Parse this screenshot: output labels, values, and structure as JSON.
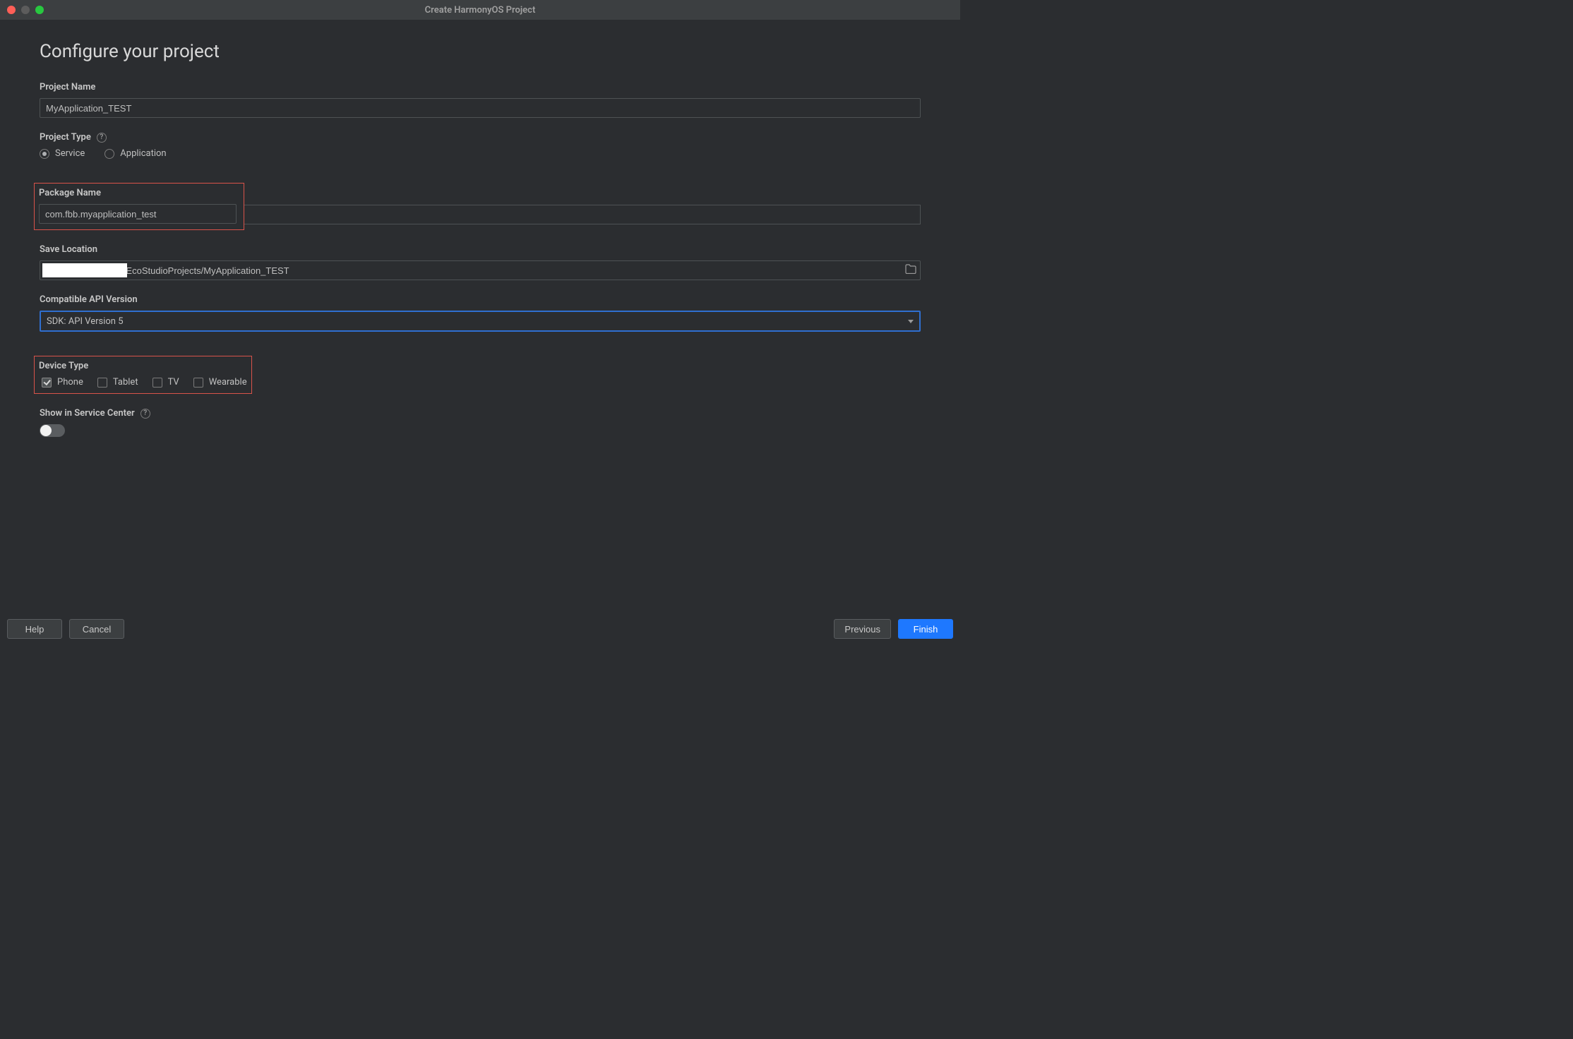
{
  "window": {
    "title": "Create HarmonyOS Project"
  },
  "page": {
    "heading": "Configure your project"
  },
  "project_name": {
    "label": "Project Name",
    "value": "MyApplication_TEST"
  },
  "project_type": {
    "label": "Project Type",
    "options": {
      "service": "Service",
      "application": "Application"
    },
    "selected": "service"
  },
  "package_name": {
    "label": "Package Name",
    "value": "com.fbb.myapplication_test"
  },
  "save_location": {
    "label": "Save Location",
    "value_suffix": "/DevEcoStudioProjects/MyApplication_TEST"
  },
  "api_version": {
    "label": "Compatible API Version",
    "selected": "SDK: API Version 5"
  },
  "device_type": {
    "label": "Device Type",
    "options": {
      "phone": {
        "label": "Phone",
        "checked": true
      },
      "tablet": {
        "label": "Tablet",
        "checked": false
      },
      "tv": {
        "label": "TV",
        "checked": false
      },
      "wearable": {
        "label": "Wearable",
        "checked": false
      }
    }
  },
  "service_center": {
    "label": "Show in Service Center",
    "on": false
  },
  "footer": {
    "help": "Help",
    "cancel": "Cancel",
    "previous": "Previous",
    "finish": "Finish"
  }
}
